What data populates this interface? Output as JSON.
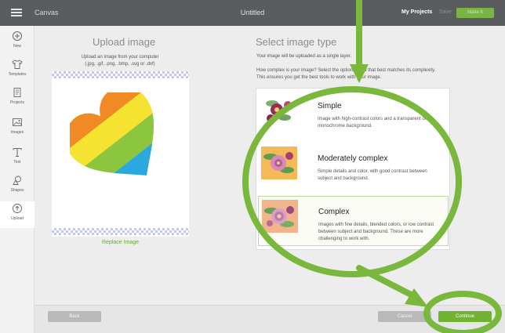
{
  "topbar": {
    "app_title": "Canvas",
    "doc_title": "Untitled",
    "my_projects": "My Projects",
    "save": "Save",
    "make": "Make It"
  },
  "sidebar": {
    "items": [
      {
        "label": "New",
        "icon": "plus-circle-icon"
      },
      {
        "label": "Templates",
        "icon": "shirt-icon"
      },
      {
        "label": "Projects",
        "icon": "projects-icon"
      },
      {
        "label": "Images",
        "icon": "image-icon"
      },
      {
        "label": "Text",
        "icon": "text-icon"
      },
      {
        "label": "Shapes",
        "icon": "shapes-icon"
      },
      {
        "label": "Upload",
        "icon": "upload-icon"
      }
    ],
    "active": "Upload"
  },
  "upload": {
    "title": "Upload image",
    "desc_line1": "Upload an image from your computer",
    "desc_line2": "(.jpg, .gif, .png, .bmp, .svg or .dxf)",
    "replace": "Replace Image",
    "heart_colors": [
      "#d62a2e",
      "#f08a24",
      "#f5e332",
      "#8cc63f",
      "#29a9e0",
      "#2e3a8c"
    ]
  },
  "image_type": {
    "title": "Select image type",
    "desc1": "Your image will be uploaded as a single layer.",
    "desc2": "How complex is your image? Select the option below that best matches its complexity. This ensures you get the best tools to work with your image.",
    "options": [
      {
        "name": "Simple",
        "desc": "Image with high-contrast colors and a transparent or monochrome background.",
        "thumb_bg": "#ffffff"
      },
      {
        "name": "Moderately complex",
        "desc": "Simple details and color, with good contrast between subject and background.",
        "thumb_bg": "#f5b95a"
      },
      {
        "name": "Complex",
        "desc": "Images with fine details, blended colors, or low contrast between subject and background. These are more challenging to work with.",
        "thumb_bg": "#f4b48b"
      }
    ],
    "selected": "Complex"
  },
  "bottom": {
    "back": "Back",
    "cancel": "Cancel",
    "continue": "Continue"
  },
  "colors": {
    "accent_green": "#71b233",
    "annotation_green": "#7ab73d",
    "topbar": "#5a5d5f"
  }
}
